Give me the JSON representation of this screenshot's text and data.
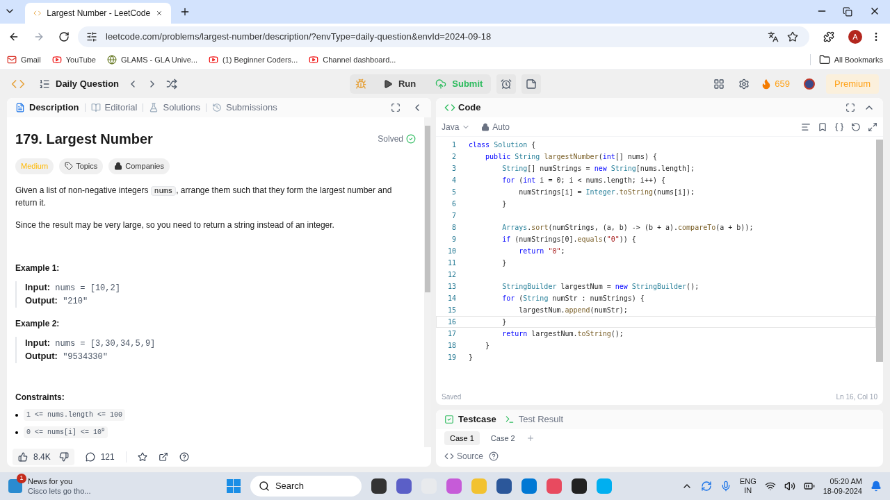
{
  "browser": {
    "tab_title": "Largest Number - LeetCode",
    "url": "leetcode.com/problems/largest-number/description/?envType=daily-question&envId=2024-09-18",
    "profile_initial": "A",
    "bookmarks": [
      {
        "label": "Gmail",
        "kind": "mail"
      },
      {
        "label": "YouTube",
        "kind": "video"
      },
      {
        "label": "GLAMS - GLA Unive...",
        "kind": "site"
      },
      {
        "label": "(1) Beginner Coders...",
        "kind": "video"
      },
      {
        "label": "Channel dashboard...",
        "kind": "video"
      }
    ],
    "all_bookmarks": "All Bookmarks"
  },
  "header": {
    "title": "Daily Question",
    "run": "Run",
    "submit": "Submit",
    "streak": "659",
    "premium": "Premium"
  },
  "description": {
    "tabs": [
      {
        "label": "Description",
        "selected": true
      },
      {
        "label": "Editorial",
        "selected": false
      },
      {
        "label": "Solutions",
        "selected": false
      },
      {
        "label": "Submissions",
        "selected": false
      }
    ],
    "title": "179. Largest Number",
    "status": "Solved",
    "tags": [
      {
        "label": "Medium",
        "kind": "difficulty"
      },
      {
        "label": "Topics",
        "kind": "topic"
      },
      {
        "label": "Companies",
        "kind": "company"
      }
    ],
    "intro": {
      "before": "Given a list of non-negative integers ",
      "code": "nums",
      "after": ", arrange them such that they form the largest number and return it."
    },
    "note": "Since the result may be very large, so you need to return a string instead of an integer.",
    "examples": [
      {
        "title": "Example 1:",
        "input_label": "Input:",
        "input": "nums = [10,2]",
        "output_label": "Output:",
        "output": "\"210\""
      },
      {
        "title": "Example 2:",
        "input_label": "Input:",
        "input": "nums = [3,30,34,5,9]",
        "output_label": "Output:",
        "output": "\"9534330\""
      }
    ],
    "constraints_title": "Constraints:",
    "constraints": [
      "1 <= nums.length <= 100",
      "0 <= nums[i] <= 10$^{9}$"
    ],
    "likes": "8.4K",
    "comments": "121"
  },
  "code": {
    "title": "Code",
    "language": "Java",
    "mode": "Auto",
    "status": "Saved",
    "position": "Ln 16, Col 10",
    "lines": [
      {
        "no": "1",
        "current": false,
        "tokens": [
          {
            "kind": "kw",
            "text": "class "
          },
          {
            "kind": "type",
            "text": "Solution"
          },
          {
            "kind": "plain",
            "text": " {"
          }
        ]
      },
      {
        "no": "2",
        "current": false,
        "tokens": [
          {
            "kind": "kw",
            "text": "    public "
          },
          {
            "kind": "type",
            "text": "String "
          },
          {
            "kind": "fn",
            "text": "largestNumber"
          },
          {
            "kind": "plain",
            "text": "("
          },
          {
            "kind": "kw",
            "text": "int"
          },
          {
            "kind": "plain",
            "text": "[] nums) {"
          }
        ]
      },
      {
        "no": "3",
        "current": false,
        "tokens": [
          {
            "kind": "type",
            "text": "        String"
          },
          {
            "kind": "plain",
            "text": "[] numStrings = "
          },
          {
            "kind": "kw",
            "text": "new "
          },
          {
            "kind": "type",
            "text": "String"
          },
          {
            "kind": "plain",
            "text": "[nums.length];"
          }
        ]
      },
      {
        "no": "4",
        "current": false,
        "tokens": [
          {
            "kind": "kw",
            "text": "        for "
          },
          {
            "kind": "plain",
            "text": "("
          },
          {
            "kind": "kw",
            "text": "int"
          },
          {
            "kind": "plain",
            "text": " i = 0; i < nums.length; i++) {"
          }
        ]
      },
      {
        "no": "5",
        "current": false,
        "tokens": [
          {
            "kind": "plain",
            "text": "            numStrings[i] = "
          },
          {
            "kind": "type",
            "text": "Integer"
          },
          {
            "kind": "plain",
            "text": "."
          },
          {
            "kind": "fn",
            "text": "toString"
          },
          {
            "kind": "plain",
            "text": "(nums[i]);"
          }
        ]
      },
      {
        "no": "6",
        "current": false,
        "tokens": [
          {
            "kind": "plain",
            "text": "        }"
          }
        ]
      },
      {
        "no": "7",
        "current": false
      },
      {
        "no": "8",
        "current": false,
        "tokens": [
          {
            "kind": "type",
            "text": "        Arrays"
          },
          {
            "kind": "plain",
            "text": "."
          },
          {
            "kind": "fn",
            "text": "sort"
          },
          {
            "kind": "plain",
            "text": "(numStrings, (a, b) -> (b + a)."
          },
          {
            "kind": "fn",
            "text": "compareTo"
          },
          {
            "kind": "plain",
            "text": "(a + b));"
          }
        ]
      },
      {
        "no": "9",
        "current": false,
        "tokens": [
          {
            "kind": "kw",
            "text": "        if "
          },
          {
            "kind": "plain",
            "text": "(numStrings[0]."
          },
          {
            "kind": "fn",
            "text": "equals"
          },
          {
            "kind": "plain",
            "text": "("
          },
          {
            "kind": "str",
            "text": "\"0\""
          },
          {
            "kind": "plain",
            "text": ")) {"
          }
        ]
      },
      {
        "no": "10",
        "current": false,
        "tokens": [
          {
            "kind": "kw",
            "text": "            return "
          },
          {
            "kind": "str",
            "text": "\"0\""
          },
          {
            "kind": "plain",
            "text": ";"
          }
        ]
      },
      {
        "no": "11",
        "current": false,
        "tokens": [
          {
            "kind": "plain",
            "text": "        }"
          }
        ]
      },
      {
        "no": "12",
        "current": false
      },
      {
        "no": "13",
        "current": false,
        "tokens": [
          {
            "kind": "type",
            "text": "        StringBuilder"
          },
          {
            "kind": "plain",
            "text": " largestNum = "
          },
          {
            "kind": "kw",
            "text": "new "
          },
          {
            "kind": "type",
            "text": "StringBuilder"
          },
          {
            "kind": "plain",
            "text": "();"
          }
        ]
      },
      {
        "no": "14",
        "current": false,
        "tokens": [
          {
            "kind": "kw",
            "text": "        for "
          },
          {
            "kind": "plain",
            "text": "("
          },
          {
            "kind": "type",
            "text": "String"
          },
          {
            "kind": "plain",
            "text": " numStr : numStrings) {"
          }
        ]
      },
      {
        "no": "15",
        "current": false,
        "tokens": [
          {
            "kind": "plain",
            "text": "            largestNum."
          },
          {
            "kind": "fn",
            "text": "append"
          },
          {
            "kind": "plain",
            "text": "(numStr);"
          }
        ]
      },
      {
        "no": "16",
        "current": true,
        "tokens": [
          {
            "kind": "plain",
            "text": "        }"
          }
        ]
      },
      {
        "no": "17",
        "current": false,
        "tokens": [
          {
            "kind": "kw",
            "text": "        return "
          },
          {
            "kind": "plain",
            "text": "largestNum."
          },
          {
            "kind": "fn",
            "text": "toString"
          },
          {
            "kind": "plain",
            "text": "();"
          }
        ]
      },
      {
        "no": "18",
        "current": false,
        "tokens": [
          {
            "kind": "plain",
            "text": "    }"
          }
        ]
      },
      {
        "no": "19",
        "current": false,
        "tokens": [
          {
            "kind": "plain",
            "text": "}"
          }
        ]
      }
    ]
  },
  "testcase": {
    "tabs": [
      {
        "label": "Testcase",
        "selected": true
      },
      {
        "label": "Test Result",
        "selected": false
      }
    ],
    "cases": [
      {
        "label": "Case 1",
        "selected": true
      },
      {
        "label": "Case 2",
        "selected": false
      }
    ],
    "source": "Source"
  },
  "taskbar": {
    "news_badge": "1",
    "news_title": "News for you",
    "news_text": "Cisco lets go tho...",
    "search": "Search",
    "lang": "ENG",
    "region": "IN",
    "time": "05:20 AM",
    "date": "18-09-2024"
  }
}
